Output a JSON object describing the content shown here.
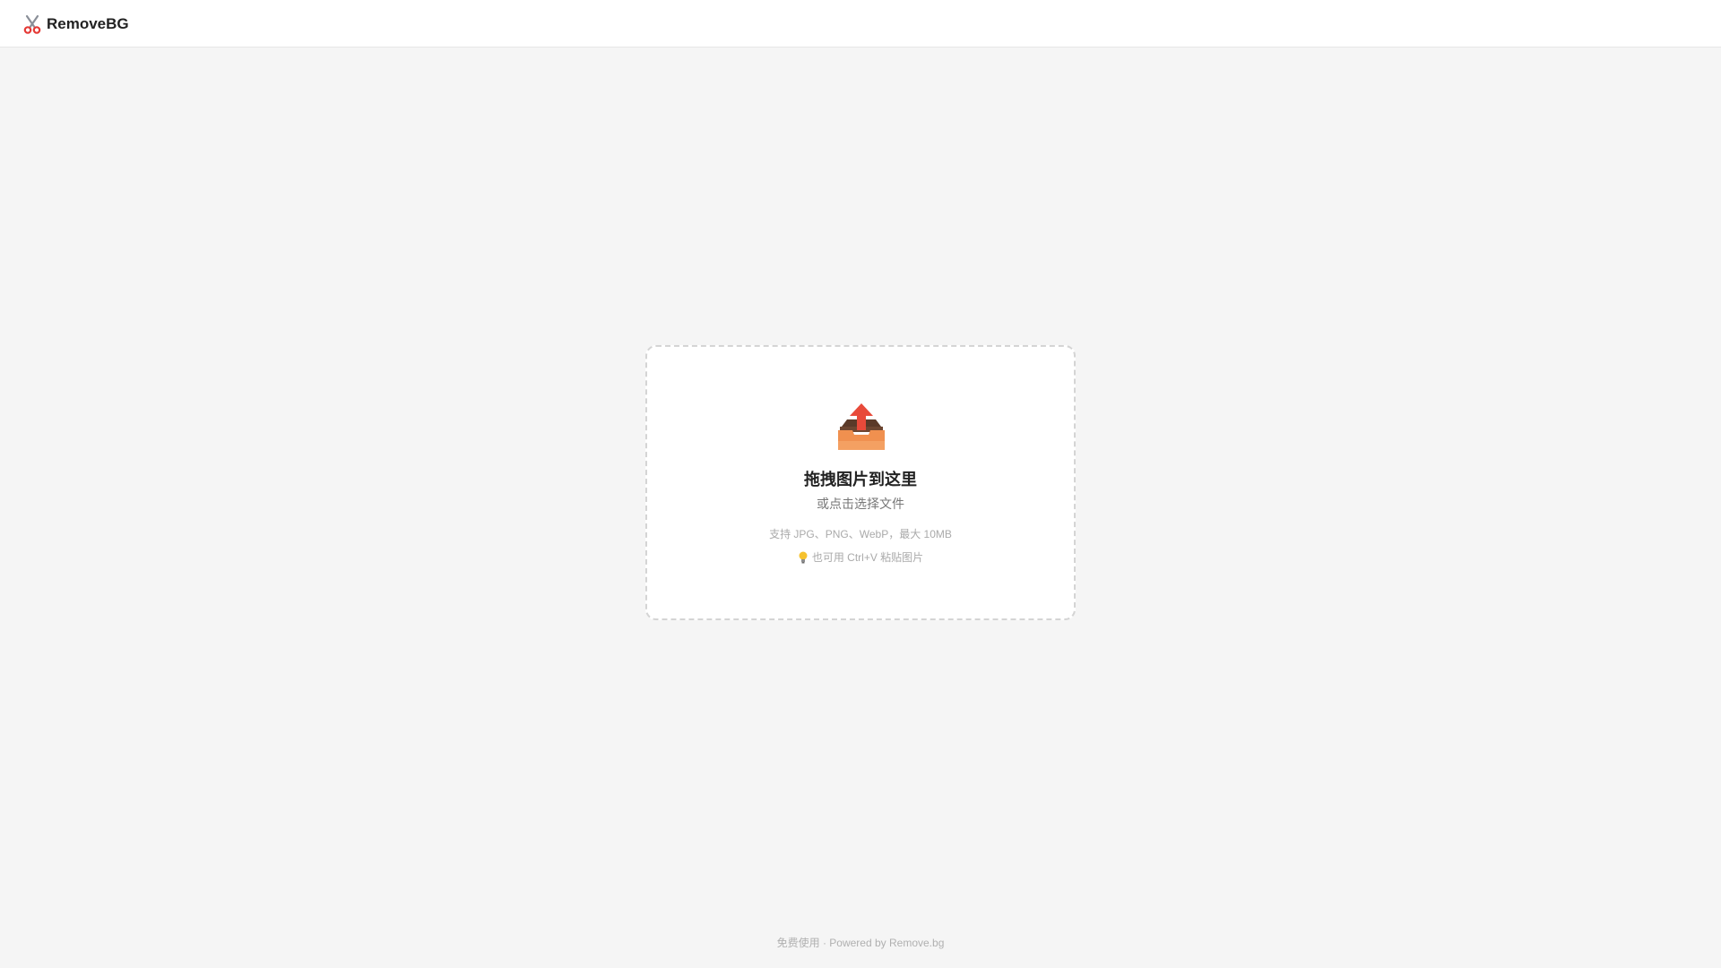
{
  "header": {
    "brand_icon": "scissors-icon",
    "brand_name": "RemoveBG"
  },
  "dropzone": {
    "icon": "inbox-upload-icon",
    "title": "拖拽图片到这里",
    "subtitle": "或点击选择文件",
    "formats": "支持 JPG、PNG、WebP，最大 10MB",
    "tip_icon": "lightbulb-icon",
    "tip": "也可用 Ctrl+V 粘贴图片"
  },
  "footer": {
    "prefix": "免费使用 · Powered by ",
    "link": "Remove.bg"
  },
  "colors": {
    "background": "#f5f5f5",
    "card": "#ffffff",
    "arrow": "#e84a3a",
    "tray": "#f0904f",
    "tray_dark": "#5b3a29"
  }
}
